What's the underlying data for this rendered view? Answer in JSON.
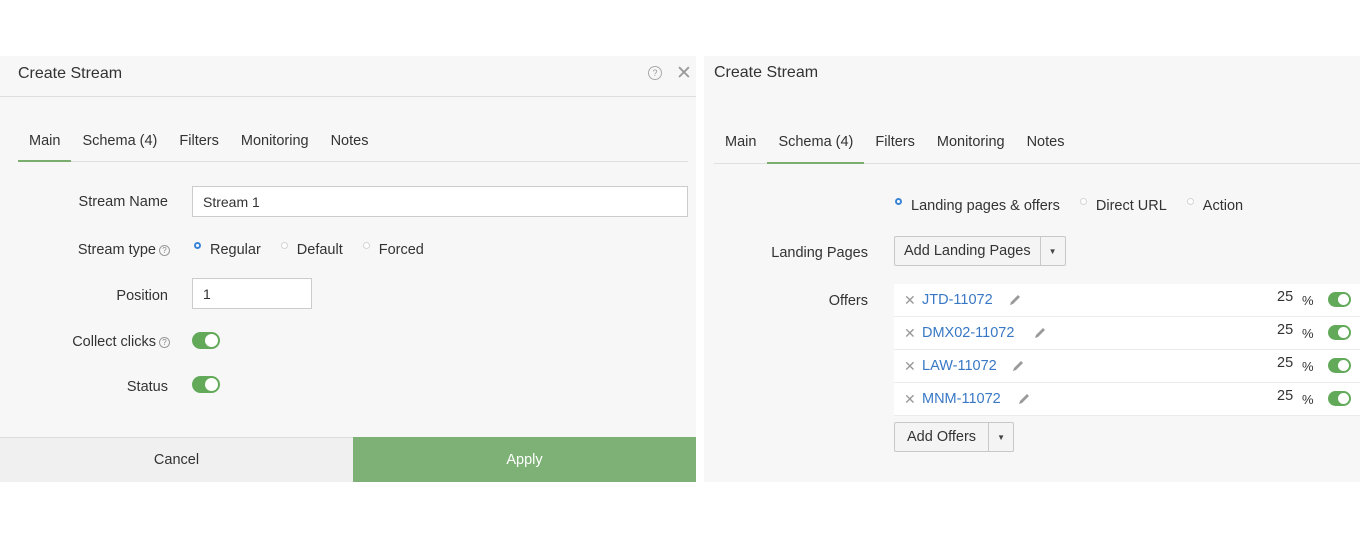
{
  "left_panel": {
    "title": "Create Stream",
    "tabs": [
      {
        "label": "Main",
        "active": true
      },
      {
        "label": "Schema (4)",
        "active": false
      },
      {
        "label": "Filters",
        "active": false
      },
      {
        "label": "Monitoring",
        "active": false
      },
      {
        "label": "Notes",
        "active": false
      }
    ],
    "stream_name_label": "Stream Name",
    "stream_name_value": "Stream 1",
    "stream_type_label": "Stream type",
    "stream_type_options": [
      {
        "label": "Regular",
        "checked": true
      },
      {
        "label": "Default",
        "checked": false
      },
      {
        "label": "Forced",
        "checked": false
      }
    ],
    "position_label": "Position",
    "position_value": "1",
    "collect_clicks_label": "Collect clicks",
    "collect_clicks_on": true,
    "status_label": "Status",
    "status_on": true,
    "cancel_label": "Cancel",
    "apply_label": "Apply"
  },
  "right_panel": {
    "title": "Create Stream",
    "tabs": [
      {
        "label": "Main",
        "active": false
      },
      {
        "label": "Schema (4)",
        "active": true
      },
      {
        "label": "Filters",
        "active": false
      },
      {
        "label": "Monitoring",
        "active": false
      },
      {
        "label": "Notes",
        "active": false
      }
    ],
    "schema_options": [
      {
        "label": "Landing pages & offers",
        "checked": true
      },
      {
        "label": "Direct URL",
        "checked": false
      },
      {
        "label": "Action",
        "checked": false
      }
    ],
    "landing_pages_label": "Landing Pages",
    "add_landing_pages_label": "Add Landing Pages",
    "offers_label": "Offers",
    "offers": [
      {
        "name": "JTD-11072",
        "weight": "25",
        "unit": "%",
        "enabled": true
      },
      {
        "name": "DMX02-11072",
        "weight": "25",
        "unit": "%",
        "enabled": true
      },
      {
        "name": "LAW-11072",
        "weight": "25",
        "unit": "%",
        "enabled": true
      },
      {
        "name": "MNM-11072",
        "weight": "25",
        "unit": "%",
        "enabled": true
      }
    ],
    "add_offers_label": "Add Offers"
  },
  "colors": {
    "accent_green": "#7db176",
    "toggle_green": "#62aa5a",
    "link_blue": "#3878c5",
    "radio_blue": "#3a84d6"
  }
}
